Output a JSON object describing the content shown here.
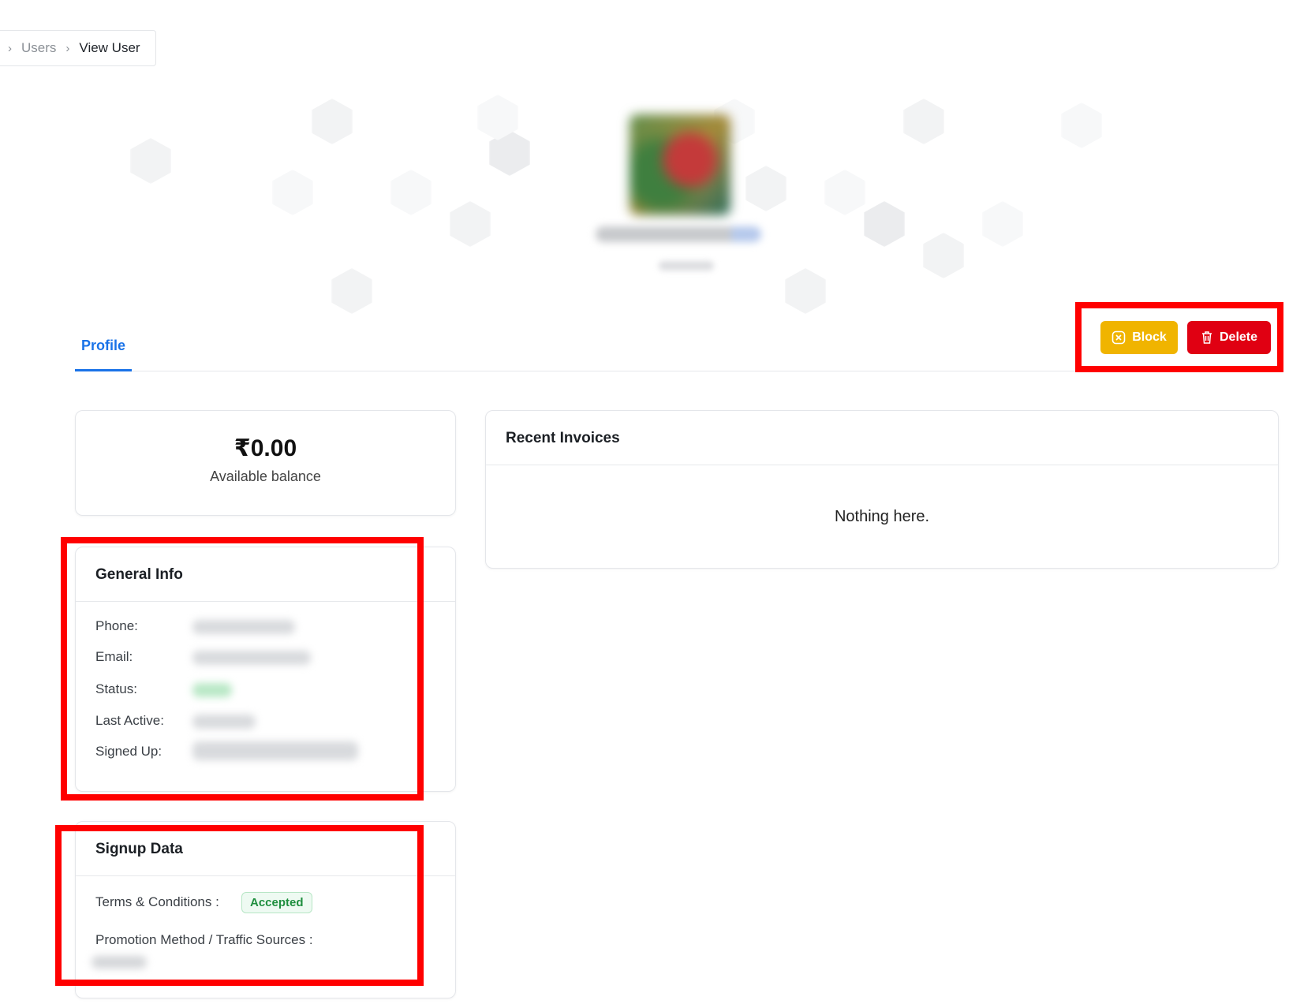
{
  "breadcrumb": {
    "items": [
      "Users",
      "View User"
    ]
  },
  "tabs": {
    "profile_label": "Profile"
  },
  "actions": {
    "block_label": "Block",
    "delete_label": "Delete",
    "block_color": "#f0b400",
    "delete_color": "#e00012"
  },
  "balance": {
    "amount": "₹0.00",
    "label": "Available balance"
  },
  "invoices": {
    "title": "Recent Invoices",
    "empty_text": "Nothing here."
  },
  "general_info": {
    "title": "General Info",
    "fields": [
      {
        "label": "Phone:"
      },
      {
        "label": "Email:"
      },
      {
        "label": "Status:"
      },
      {
        "label": "Last Active:"
      },
      {
        "label": "Signed Up:"
      }
    ]
  },
  "signup_data": {
    "title": "Signup Data",
    "terms_label": "Terms & Conditions :",
    "terms_status": "Accepted",
    "promotion_label": "Promotion Method / Traffic Sources :"
  },
  "colors": {
    "accent": "#1a73e8",
    "success": "#1e8e3e",
    "annotation": "#ff0000"
  }
}
